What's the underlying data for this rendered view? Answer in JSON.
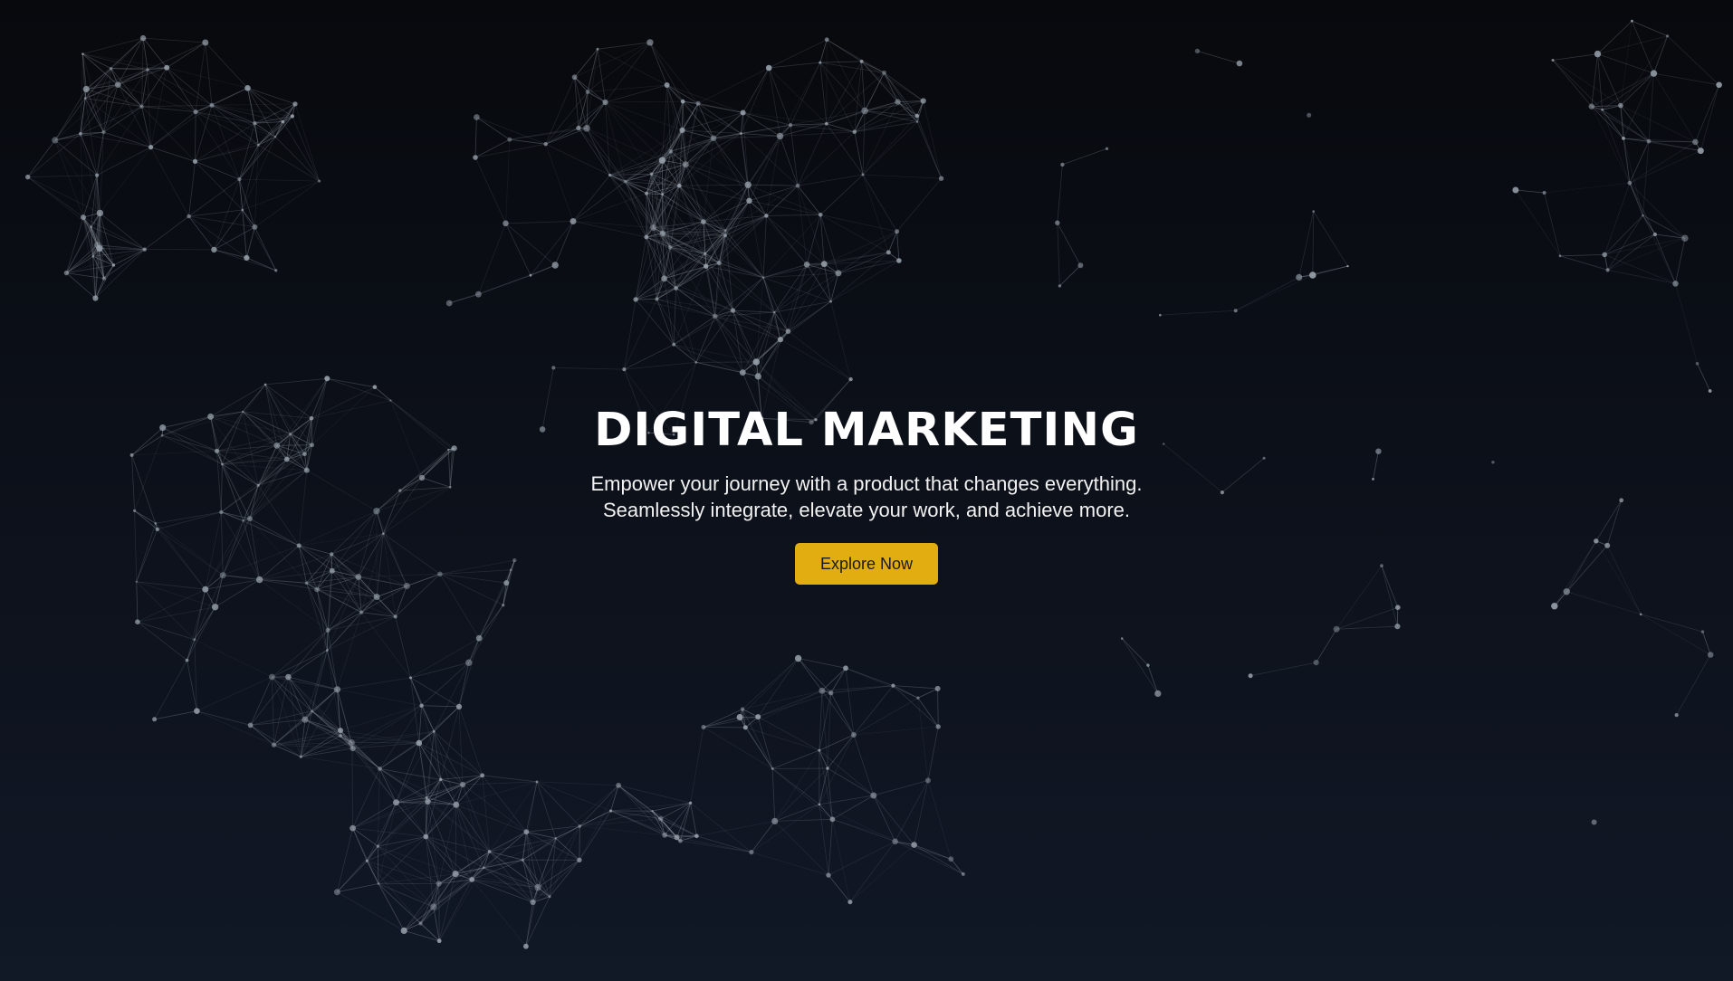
{
  "hero": {
    "title": "DIGITAL MARKETING",
    "subtitle_line1": "Empower your journey with a product that changes everything.",
    "subtitle_line2": "Seamlessly integrate, elevate your work, and achieve more.",
    "cta_label": "Explore Now"
  },
  "theme": {
    "background_top": "#07090d",
    "background_bottom": "#111826",
    "accent": "#e2ad10",
    "text": "#ffffff",
    "network_color": "#9aa3ad"
  },
  "background": {
    "icon": "particle-network"
  }
}
